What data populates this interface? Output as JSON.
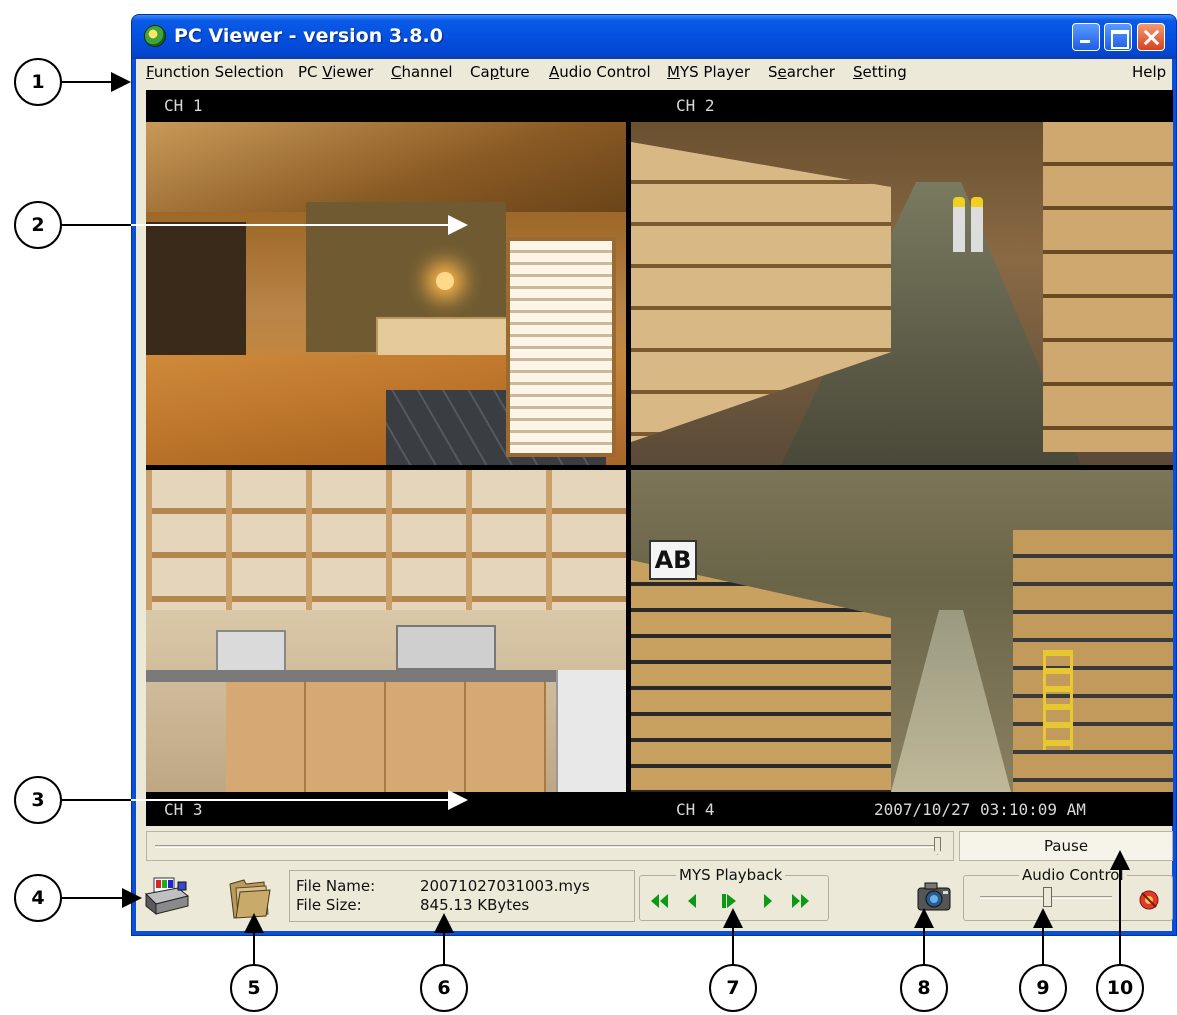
{
  "window": {
    "title": "PC Viewer - version 3.8.0",
    "controls": [
      "minimize-icon",
      "maximize-icon",
      "close-icon"
    ]
  },
  "menu": {
    "items": [
      {
        "label": "Function Selection",
        "accel": "F"
      },
      {
        "label": "PC Viewer",
        "accel": "V"
      },
      {
        "label": "Channel",
        "accel": "C"
      },
      {
        "label": "Capture",
        "accel": "p"
      },
      {
        "label": "Audio Control",
        "accel": "A"
      },
      {
        "label": "MYS Player",
        "accel": "M"
      },
      {
        "label": "Searcher",
        "accel": "e"
      },
      {
        "label": "Setting",
        "accel": "S"
      }
    ],
    "help": "Help"
  },
  "video": {
    "ch1": "CH 1",
    "ch2": "CH 2",
    "ch3": "CH 3",
    "ch4": "CH 4",
    "timestamp": "2007/10/27 03:10:09 AM",
    "ch4_sign": "AB"
  },
  "playback_position": 1.0,
  "pause_label": "Pause",
  "file_info": {
    "name_label": "File Name:",
    "name_value": "20071027031003.mys",
    "size_label": "File Size:",
    "size_value": "845.13 KBytes"
  },
  "mys_playback": {
    "title": "MYS Playback",
    "buttons": [
      "rewind-icon",
      "step-back-icon",
      "play-icon",
      "step-forward-icon",
      "fast-forward-icon"
    ]
  },
  "audio_control": {
    "title": "Audio Control",
    "volume": 0.5
  },
  "icons": [
    "printer-icon",
    "folder-icon",
    "camera-icon",
    "mute-icon"
  ],
  "callouts": [
    "1",
    "2",
    "3",
    "4",
    "5",
    "6",
    "7",
    "8",
    "9",
    "10"
  ],
  "colors": {
    "titlebar": "#0450e0",
    "client": "#ece9d8",
    "playback_green": "#0a9a16"
  }
}
